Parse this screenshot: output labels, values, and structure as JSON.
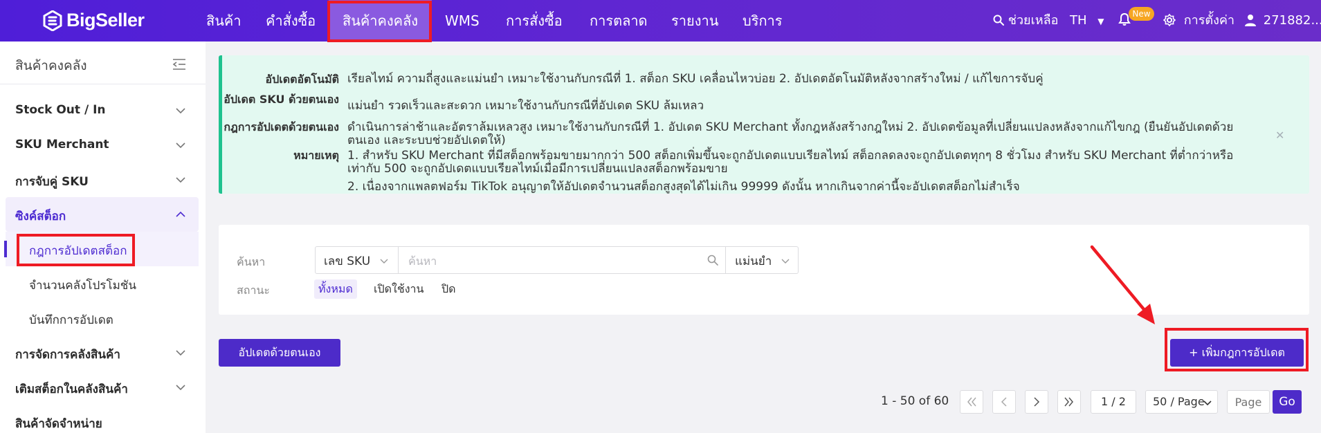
{
  "logo": {
    "text": "BigSeller"
  },
  "nav": {
    "items": [
      "สินค้า",
      "คำสั่งซื้อ",
      "สินค้าคงคลัง",
      "WMS",
      "การสั่งซื้อ",
      "การตลาด",
      "รายงาน",
      "บริการ"
    ],
    "active_index": 2,
    "help_label": "ช่วยเหลือ",
    "lang": "TH",
    "new_badge": "New",
    "settings_label": "การตั้งค่า",
    "user": "271882..."
  },
  "sidebar": {
    "title": "สินค้าคงคลัง",
    "groups": [
      {
        "label": "Stock Out / In"
      },
      {
        "label": "SKU Merchant"
      },
      {
        "label": "การจับคู่ SKU"
      },
      {
        "label": "ซิงค์สต็อก",
        "expanded": true,
        "children": [
          "กฎการอัปเดตสต็อก",
          "จำนวนคลังโปรโมชัน",
          "บันทึกการอัปเดต"
        ],
        "active_child": 0
      },
      {
        "label": "การจัดการคลังสินค้า"
      },
      {
        "label": "เติมสต็อกในคลังสินค้า"
      },
      {
        "label": "สินค้าจัดจำหน่าย"
      }
    ]
  },
  "info": {
    "rows": [
      {
        "label": "อัปเดตอัตโนมัติ",
        "text": "เรียลไทม์ ความถี่สูงและแม่นยำ เหมาะใช้งานกับกรณีที่ 1. สต็อก SKU เคลื่อนไหวบ่อย 2. อัปเดตอัตโนมัติหลังจากสร้างใหม่ / แก้ไขการจับคู่"
      },
      {
        "label": "อัปเดต SKU ด้วยตนเอง",
        "text": "แม่นยำ รวดเร็วและสะดวก เหมาะใช้งานกับกรณีที่อัปเดต SKU ล้มเหลว"
      },
      {
        "label": "กฎการอัปเดตด้วยตนเอง",
        "text": "ดำเนินการล่าช้าและอัตราล้มเหลวสูง เหมาะใช้งานกับกรณีที่ 1. อัปเดต SKU Merchant ทั้งกฎหลังสร้างกฎใหม่ 2. อัปเดตข้อมูลที่เปลี่ยนแปลงหลังจากแก้ไขกฎ (ยืนยันอัปเดตด้วยตนเอง และระบบช่วยอัปเดตให้)"
      },
      {
        "label": "หมายเหตุ",
        "text": "1. สำหรับ SKU Merchant ที่มีสต็อกพร้อมขายมากกว่า 500 สต็อกเพิ่มขึ้นจะถูกอัปเดตแบบเรียลไทม์ สต็อกลดลงจะถูกอัปเดตทุกๆ 8 ชั่วโมง สำหรับ SKU Merchant ที่ต่ำกว่าหรือเท่ากับ 500 จะถูกอัปเดตแบบเรียลไทม์เมื่อมีการเปลี่ยนแปลงสต็อกพร้อมขาย"
      },
      {
        "label": "",
        "text": "2. เนื่องจากแพลตฟอร์ม TikTok อนุญาตให้อัปเดตจำนวนสต็อกสูงสุดได้ไม่เกิน 99999 ดังนั้น หากเกินจากค่านี้จะอัปเดตสต็อกไม่สำเร็จ"
      }
    ]
  },
  "filter": {
    "search_label": "ค้นหา",
    "search_type": "เลข SKU",
    "search_placeholder": "ค้นหา",
    "match_mode": "แม่นยำ",
    "status_label": "สถานะ",
    "status_options": [
      "ทั้งหมด",
      "เปิดใช้งาน",
      "ปิด"
    ],
    "status_selected": 0
  },
  "actions": {
    "manual_update": "อัปเดตด้วยตนเอง",
    "add_rule": "+ เพิ่มกฎการอัปเดต"
  },
  "pagination": {
    "range": "1 - 50 of 60",
    "page": "1 / 2",
    "per_page": "50 / Page",
    "page_placeholder": "Page",
    "go": "Go"
  },
  "colors": {
    "nav_bg": "#5a24d4",
    "primary": "#4d2bc9",
    "info_bg": "#e3f9f1",
    "info_border": "#1fc28f",
    "annotation": "#ee1b24",
    "badge": "#f6a623"
  }
}
